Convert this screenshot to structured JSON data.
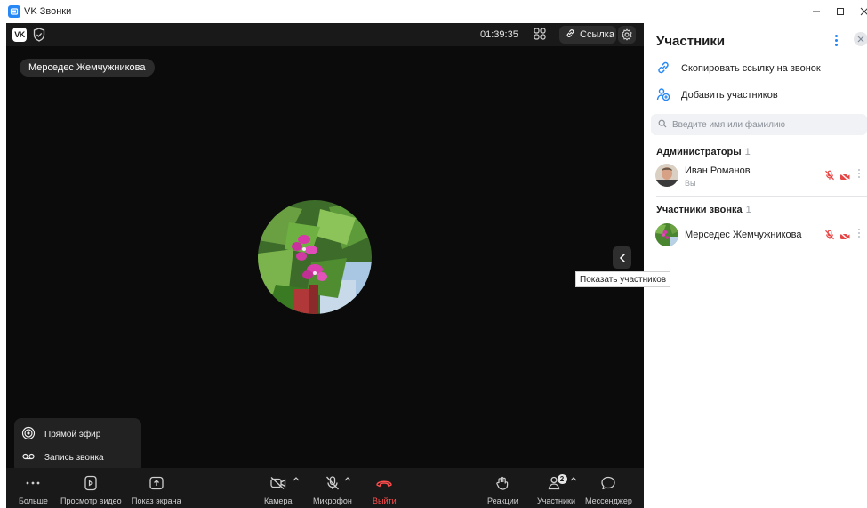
{
  "window": {
    "title": "VK Звонки",
    "controls": [
      "minimize-icon",
      "maximize-icon",
      "close-icon"
    ]
  },
  "call": {
    "timer": "01:39:35",
    "link_label": "Ссылка",
    "speaker_name": "Мерседес Жемчужникова",
    "show_participants_tooltip": "Показать участников"
  },
  "popup_menu": {
    "items": [
      {
        "label": "Прямой эфир",
        "icon": "broadcast-icon"
      },
      {
        "label": "Запись звонка",
        "icon": "recording-icon"
      }
    ]
  },
  "toolbar": {
    "more": "Больше",
    "view_video": "Просмотр видео",
    "screen_share": "Показ экрана",
    "camera": "Камера",
    "microphone": "Микрофон",
    "leave": "Выйти",
    "reactions": "Реакции",
    "participants": "Участники",
    "participants_badge": "2",
    "messenger": "Мессенджер"
  },
  "panel": {
    "title": "Участники",
    "copy_link": "Скопировать ссылку на звонок",
    "add_participants": "Добавить участников",
    "search_placeholder": "Введите имя или фамилию",
    "admins_title": "Администраторы",
    "admins_count": "1",
    "members_title": "Участники звонка",
    "members_count": "1",
    "admins": [
      {
        "name": "Иван Романов",
        "sub": "Вы"
      }
    ],
    "members": [
      {
        "name": "Мерседес Жемчужникова"
      }
    ]
  },
  "colors": {
    "accent": "#2787f5",
    "muted_red": "#e64646",
    "leave_red": "#ff4c4c",
    "call_background": "#0b0b0b",
    "bar_background": "#191919"
  }
}
